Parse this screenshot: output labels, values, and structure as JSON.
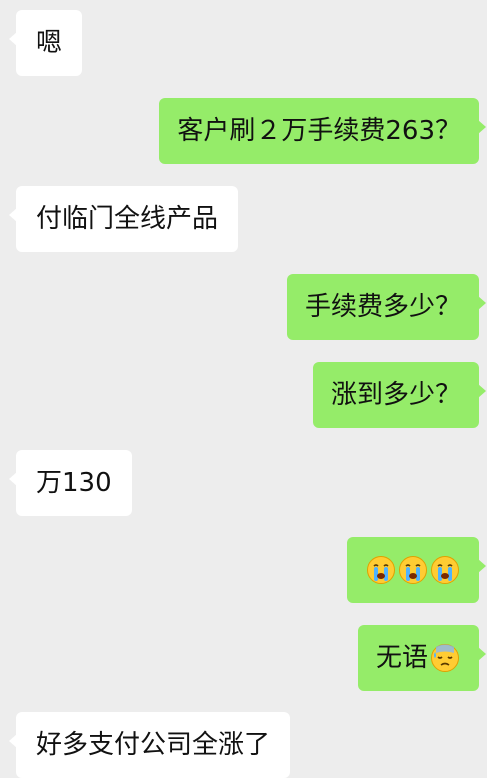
{
  "chat": {
    "messages": [
      {
        "side": "left",
        "text": "嗯"
      },
      {
        "side": "right",
        "text": "客户刷２万手续费263？"
      },
      {
        "side": "left",
        "text": "付临门全线产品"
      },
      {
        "side": "right",
        "text": "手续费多少？"
      },
      {
        "side": "right",
        "text": "涨到多少？"
      },
      {
        "side": "left",
        "text": "万130"
      },
      {
        "side": "right",
        "text": "",
        "emoji": [
          "loudly-crying-face",
          "loudly-crying-face",
          "loudly-crying-face"
        ]
      },
      {
        "side": "right",
        "text": "无语",
        "emoji": [
          "downcast-face-with-sweat"
        ]
      },
      {
        "side": "left",
        "text": "好多支付公司全涨了"
      }
    ]
  },
  "colors": {
    "background": "#ededed",
    "bubble_left": "#ffffff",
    "bubble_right": "#95ec69"
  }
}
